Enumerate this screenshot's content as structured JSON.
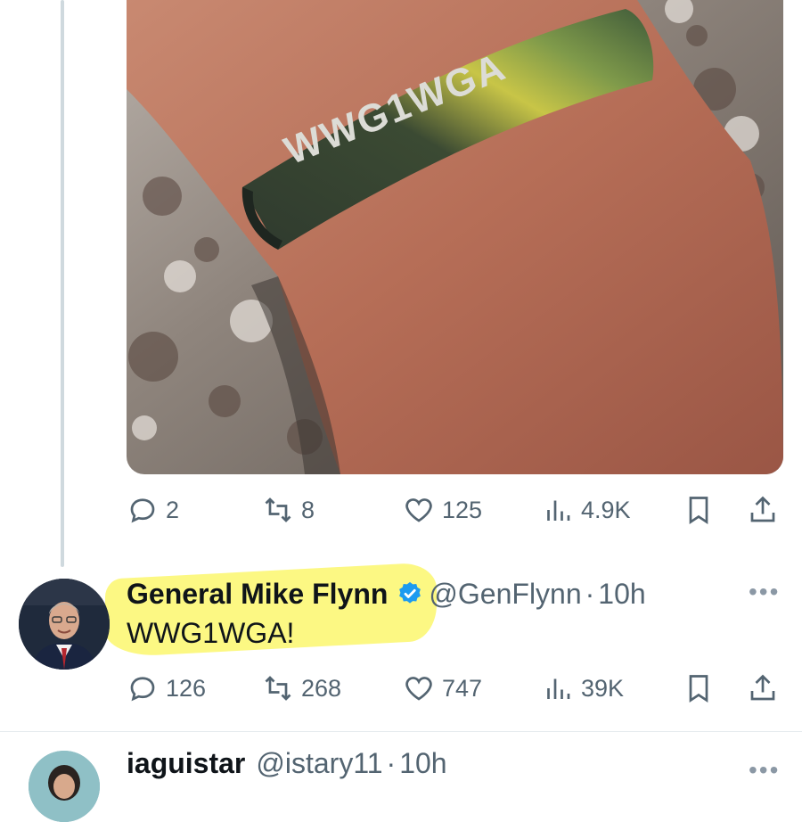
{
  "media": {
    "bracelet_text": "WWG1WGA"
  },
  "parent_actions": {
    "replies": "2",
    "reposts": "8",
    "likes": "125",
    "views": "4.9K"
  },
  "reply_tweet": {
    "display_name": "General Mike Flynn",
    "handle": "@GenFlynn",
    "separator": "·",
    "time": "10h",
    "text": "WWG1WGA!",
    "more": "•••",
    "actions": {
      "replies": "126",
      "reposts": "268",
      "likes": "747",
      "views": "39K"
    }
  },
  "next_tweet": {
    "display_name": "iaguistar",
    "handle": "@istary11",
    "separator": "·",
    "time": "10h",
    "more": "•••"
  },
  "colors": {
    "text_primary": "#0f1419",
    "text_secondary": "#536471",
    "verified_blue": "#1d9bf0",
    "highlight_yellow": "#fbf76d",
    "thread_line": "#cfd9de"
  },
  "icons": {
    "reply": "reply-icon",
    "repost": "repost-icon",
    "like": "like-icon",
    "views": "views-icon",
    "bookmark": "bookmark-icon",
    "share": "share-icon",
    "verified": "verified-badge-icon",
    "more": "more-icon"
  }
}
